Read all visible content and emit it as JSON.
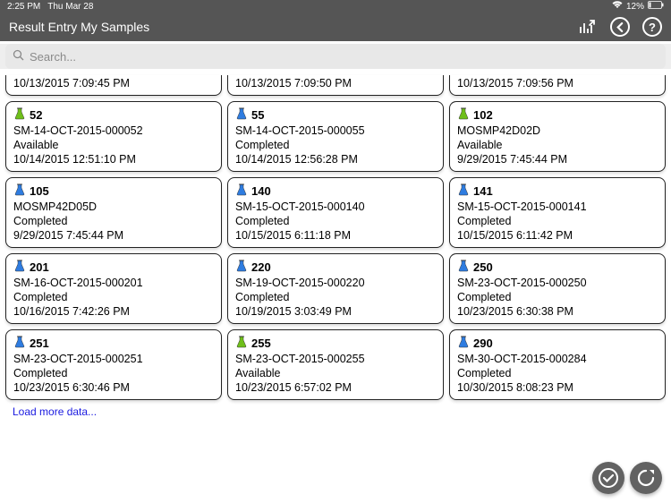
{
  "status": {
    "time": "2:25 PM",
    "date": "Thu Mar 28",
    "battery": "12%"
  },
  "nav": {
    "title": "Result Entry My Samples"
  },
  "search": {
    "placeholder": "Search..."
  },
  "partial_row": [
    {
      "time": "10/13/2015 7:09:45 PM"
    },
    {
      "time": "10/13/2015 7:09:50 PM"
    },
    {
      "time": "10/13/2015 7:09:56 PM"
    }
  ],
  "cards": [
    {
      "id": "52",
      "name": "SM-14-OCT-2015-000052",
      "status": "Available",
      "time": "10/14/2015 12:51:10 PM",
      "flask": "green"
    },
    {
      "id": "55",
      "name": "SM-14-OCT-2015-000055",
      "status": "Completed",
      "time": "10/14/2015 12:56:28 PM",
      "flask": "blue"
    },
    {
      "id": "102",
      "name": "MOSMP42D02D",
      "status": "Available",
      "time": "9/29/2015 7:45:44 PM",
      "flask": "green"
    },
    {
      "id": "105",
      "name": "MOSMP42D05D",
      "status": "Completed",
      "time": "9/29/2015 7:45:44 PM",
      "flask": "blue"
    },
    {
      "id": "140",
      "name": "SM-15-OCT-2015-000140",
      "status": "Completed",
      "time": "10/15/2015 6:11:18 PM",
      "flask": "blue"
    },
    {
      "id": "141",
      "name": "SM-15-OCT-2015-000141",
      "status": "Completed",
      "time": "10/15/2015 6:11:42 PM",
      "flask": "blue"
    },
    {
      "id": "201",
      "name": "SM-16-OCT-2015-000201",
      "status": "Completed",
      "time": "10/16/2015 7:42:26 PM",
      "flask": "blue"
    },
    {
      "id": "220",
      "name": "SM-19-OCT-2015-000220",
      "status": "Completed",
      "time": "10/19/2015 3:03:49 PM",
      "flask": "blue"
    },
    {
      "id": "250",
      "name": "SM-23-OCT-2015-000250",
      "status": "Completed",
      "time": "10/23/2015 6:30:38 PM",
      "flask": "blue"
    },
    {
      "id": "251",
      "name": "SM-23-OCT-2015-000251",
      "status": "Completed",
      "time": "10/23/2015 6:30:46 PM",
      "flask": "blue"
    },
    {
      "id": "255",
      "name": "SM-23-OCT-2015-000255",
      "status": "Available",
      "time": "10/23/2015 6:57:02 PM",
      "flask": "green"
    },
    {
      "id": "290",
      "name": "SM-30-OCT-2015-000284",
      "status": "Completed",
      "time": "10/30/2015 8:08:23 PM",
      "flask": "blue"
    }
  ],
  "load_more": "Load more data...",
  "colors": {
    "flask_green": "#6FBF1A",
    "flask_blue": "#2E7CE0"
  }
}
